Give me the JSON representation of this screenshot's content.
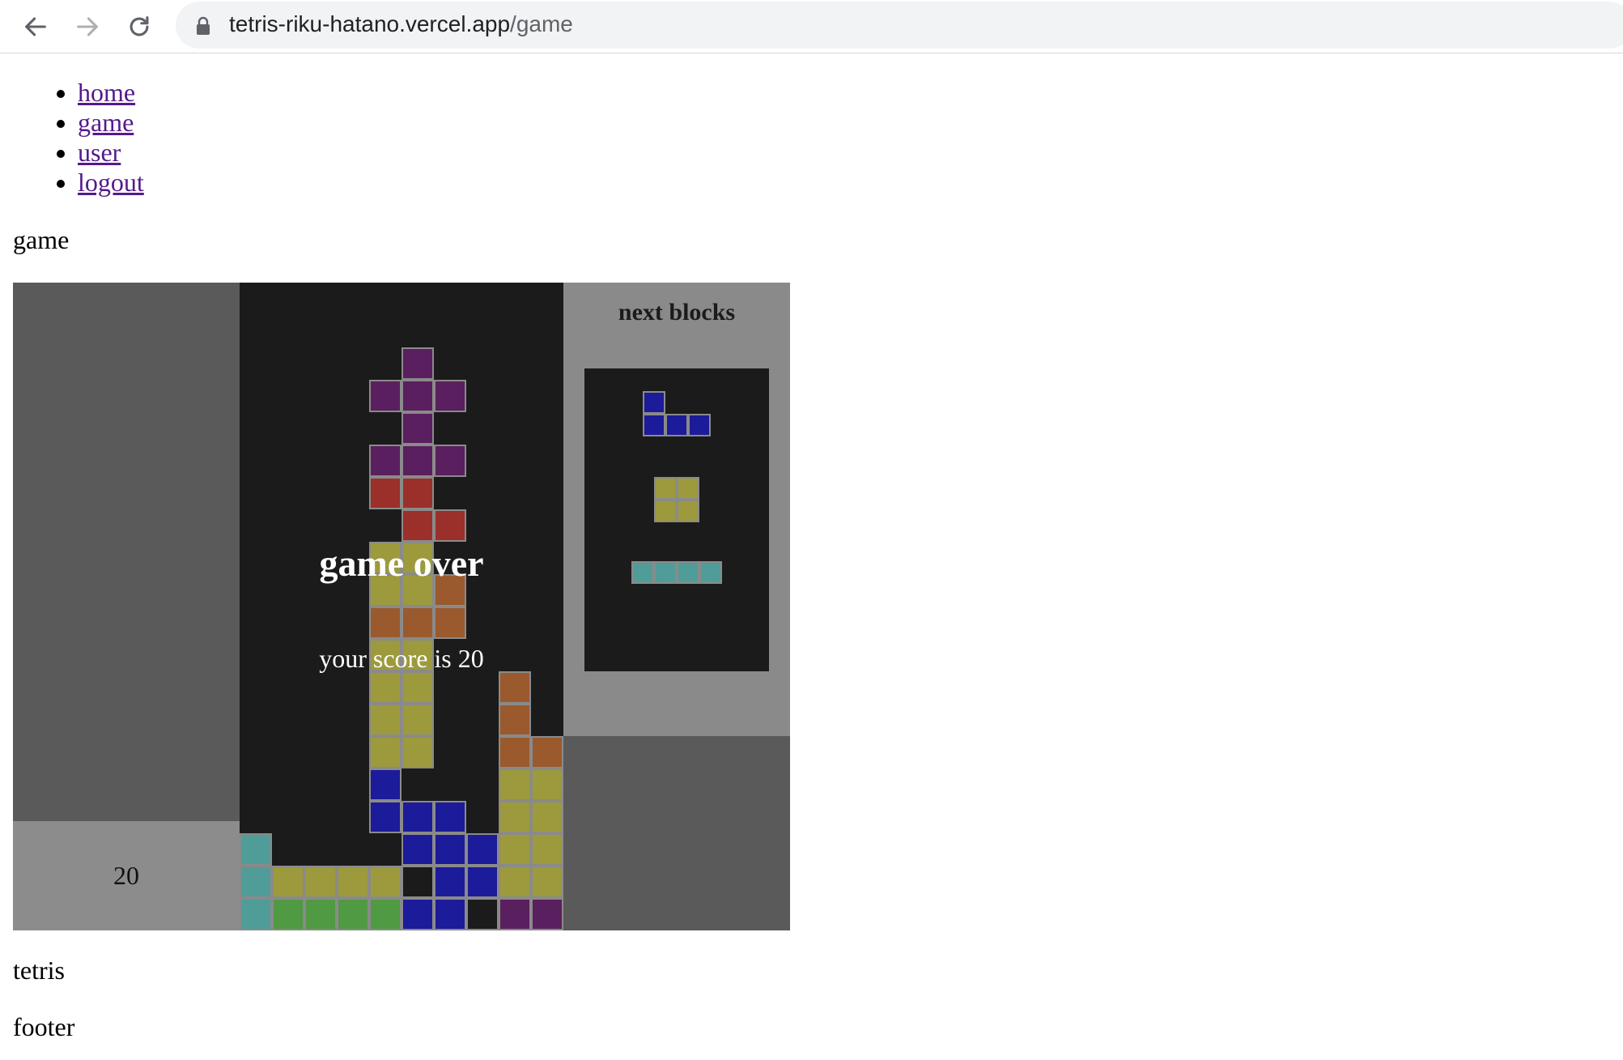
{
  "browser": {
    "url_host": "tetris-riku-hatano.vercel.app",
    "url_path": "/game",
    "back_icon": "arrow-left-icon",
    "forward_icon": "arrow-right-icon",
    "reload_icon": "reload-icon",
    "lock_icon": "lock-icon"
  },
  "nav": {
    "items": [
      {
        "label": "home"
      },
      {
        "label": "game"
      },
      {
        "label": "user"
      },
      {
        "label": "logout"
      }
    ]
  },
  "page": {
    "heading": "game",
    "tetris_label": "tetris",
    "footer_label": "footer"
  },
  "game": {
    "score": "20",
    "overlay_title": "game over",
    "overlay_score": "your score is 20",
    "next_title": "next blocks",
    "colors": {
      "P": "#5a1f5e",
      "R": "#9b2f2a",
      "O": "#9a5a2e",
      "Y": "#9c9a3c",
      "B": "#1c1b99",
      "C": "#4f9c99",
      "G": "#4f9a42",
      "K": "#1b1b1b"
    },
    "board": [
      "..........",
      "..........",
      ".....P....",
      "....PPP...",
      ".....P....",
      "....PPP...",
      "....RR....",
      ".....RR...",
      "....YY....",
      "....YYO...",
      "....OOO...",
      "....YY....",
      "....YY..O.",
      "....YY..O.",
      "....YY..OO",
      "....B...YY",
      "....BBB.YY",
      "C....BBBYY",
      "CYYYYKBBYY",
      "CGGGGBBKPP"
    ],
    "next_blocks": [
      {
        "shape": [
          "B..",
          "BBB"
        ]
      },
      {
        "shape": [
          "YY",
          "YY"
        ]
      },
      {
        "shape": [
          "CCCC"
        ]
      }
    ]
  }
}
